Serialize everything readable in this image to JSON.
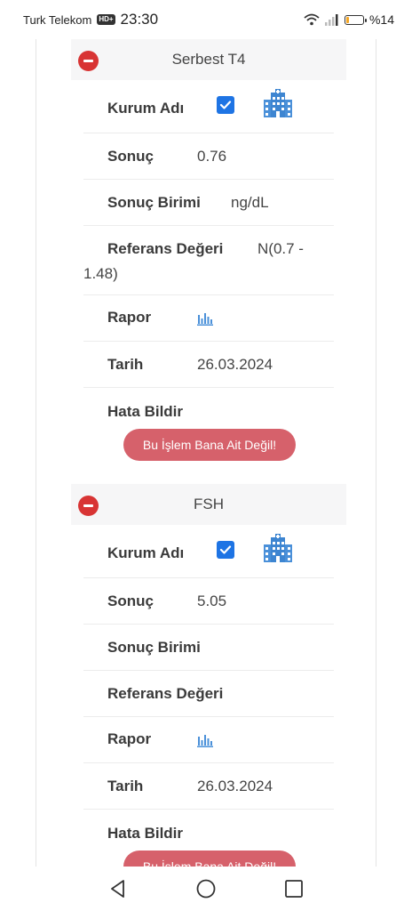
{
  "status_bar": {
    "carrier": "Turk Telekom",
    "hd_badge": "HD+",
    "time": "23:30",
    "battery_text": "%14",
    "battery_level": 0.14
  },
  "sections": [
    {
      "title": "Serbest T4",
      "rows": {
        "kurum_label": "Kurum Adı",
        "kurum_checked": true,
        "sonuc_label": "Sonuç",
        "sonuc_value": "0.76",
        "birim_label": "Sonuç Birimi",
        "birim_value": "ng/dL",
        "referans_label": "Referans Değeri",
        "referans_value_line1": "N(0.7 -",
        "referans_value_line2": "1.48)",
        "rapor_label": "Rapor",
        "tarih_label": "Tarih",
        "tarih_value": "26.03.2024",
        "hata_label": "Hata Bildir",
        "hata_button": "Bu İşlem Bana Ait Değil!"
      }
    },
    {
      "title": "FSH",
      "rows": {
        "kurum_label": "Kurum Adı",
        "kurum_checked": true,
        "sonuc_label": "Sonuç",
        "sonuc_value": "5.05",
        "birim_label": "Sonuç Birimi",
        "referans_label": "Referans Değeri",
        "rapor_label": "Rapor",
        "tarih_label": "Tarih",
        "tarih_value": "26.03.2024",
        "hata_label": "Hata Bildir",
        "hata_button": "Bu İşlem Bana Ait Değil!"
      }
    }
  ],
  "icons": {
    "remove": "minus-circle-icon",
    "institution": "hospital-icon",
    "report": "bar-chart-icon",
    "check": "check-icon",
    "nav_back": "back-triangle-icon",
    "nav_home": "home-circle-icon",
    "nav_recent": "recent-square-icon"
  },
  "colors": {
    "remove_red": "#d83434",
    "checkbox_blue": "#1e74e4",
    "hospital_blue": "#4a90d9",
    "error_button": "#d6616b",
    "header_bg": "#f6f6f7"
  }
}
